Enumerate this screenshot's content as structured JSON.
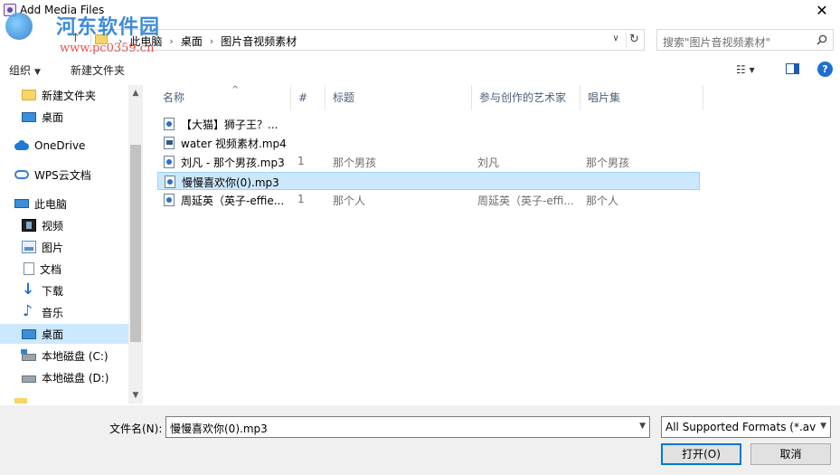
{
  "window": {
    "title": "Add Media Files",
    "close_glyph": "✕"
  },
  "watermark": {
    "line1": "河东软件园",
    "line2": "www.pc0359.cn"
  },
  "address": {
    "breadcrumbs": [
      "此电脑",
      "桌面",
      "图片音视频素材"
    ],
    "search_placeholder": "搜索\"图片音视频素材\""
  },
  "toolbar": {
    "organize": "组织",
    "new_folder": "新建文件夹",
    "help": "?"
  },
  "sidebar": {
    "items": [
      {
        "label": "新建文件夹",
        "icon": "folder-icon"
      },
      {
        "label": "桌面",
        "icon": "desktop-icon"
      },
      {
        "label": "OneDrive",
        "icon": "onedrive-icon"
      },
      {
        "label": "WPS云文档",
        "icon": "wps-cloud-icon"
      },
      {
        "label": "此电脑",
        "icon": "this-pc-icon"
      },
      {
        "label": "视频",
        "icon": "videos-icon"
      },
      {
        "label": "图片",
        "icon": "pictures-icon"
      },
      {
        "label": "文档",
        "icon": "documents-icon"
      },
      {
        "label": "下载",
        "icon": "downloads-icon"
      },
      {
        "label": "音乐",
        "icon": "music-icon"
      },
      {
        "label": "桌面",
        "icon": "desktop-icon",
        "selected": true
      },
      {
        "label": "本地磁盘 (C:)",
        "icon": "drive-c-icon"
      },
      {
        "label": "本地磁盘 (D:)",
        "icon": "drive-d-icon"
      }
    ]
  },
  "files": {
    "columns": [
      "名称",
      "#",
      "标题",
      "参与创作的艺术家",
      "唱片集"
    ],
    "rows": [
      {
        "name": "【大猫】狮子王？...",
        "num": "",
        "title": "",
        "artist": "",
        "album": "",
        "type": "audio"
      },
      {
        "name": "water 视频素材.mp4",
        "num": "",
        "title": "",
        "artist": "",
        "album": "",
        "type": "video"
      },
      {
        "name": "刘凡 - 那个男孩.mp3",
        "num": "1",
        "title": "那个男孩",
        "artist": "刘凡",
        "album": "那个男孩",
        "type": "audio"
      },
      {
        "name": "慢慢喜欢你(0).mp3",
        "num": "",
        "title": "",
        "artist": "",
        "album": "",
        "type": "audio",
        "selected": true
      },
      {
        "name": "周延英（英子-effie...",
        "num": "1",
        "title": "那个人",
        "artist": "周延英（英子-effi...",
        "album": "那个人",
        "type": "audio"
      }
    ]
  },
  "footer": {
    "filename_label": "文件名(N):",
    "filename_value": "慢慢喜欢你(0).mp3",
    "format_value": "All Supported Formats (*.avi;",
    "open_button": "打开(O)",
    "cancel_button": "取消"
  }
}
